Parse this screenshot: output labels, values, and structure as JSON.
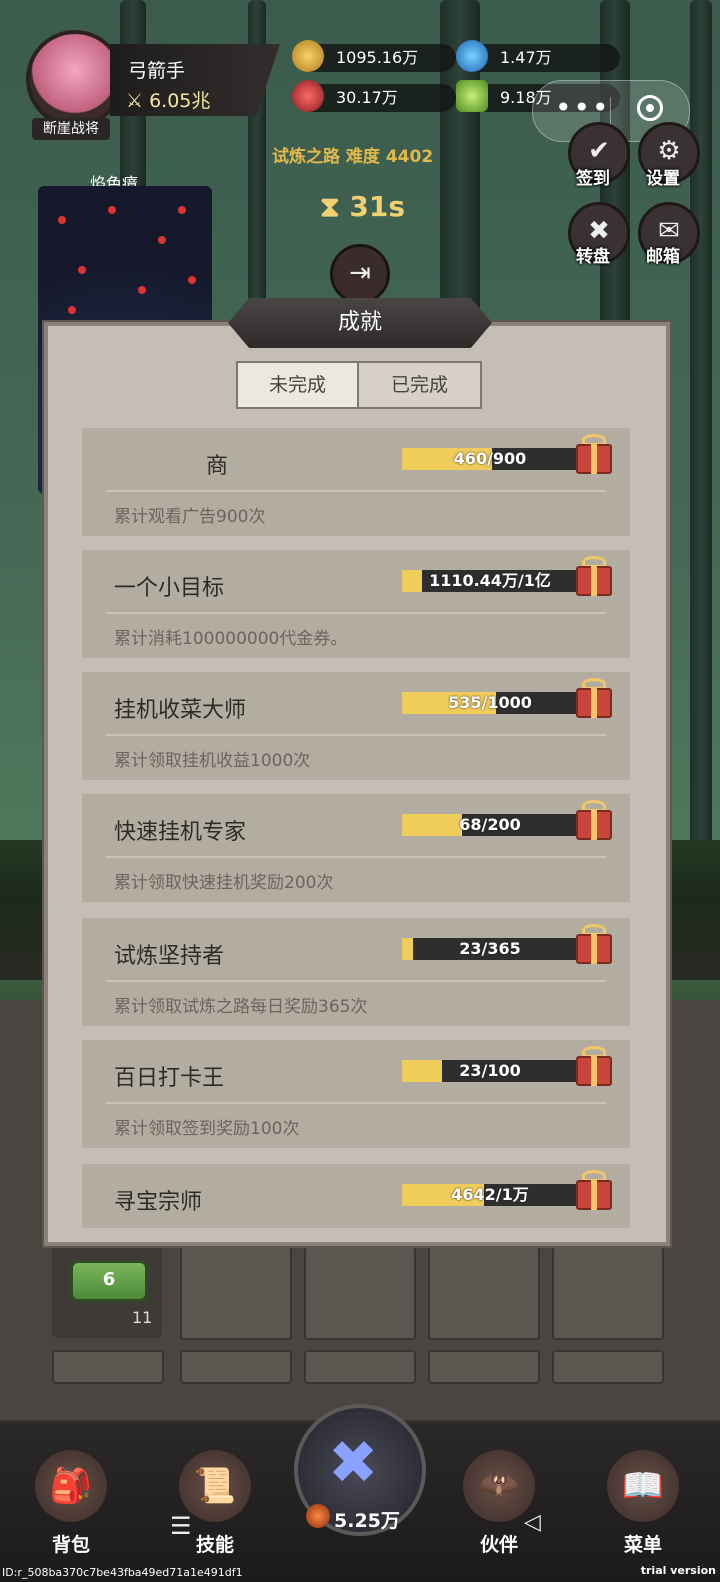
{
  "hud": {
    "hero_name": "弓箭手",
    "power": "6.05兆",
    "rank_tag": "断崖战将",
    "resources": [
      {
        "icon": "gold-star-coin-icon",
        "value": "1095.16万"
      },
      {
        "icon": "blue-gem-icon",
        "value": "1.47万"
      },
      {
        "icon": "red-ruby-icon",
        "value": "30.17万"
      },
      {
        "icon": "green-ticket-icon",
        "value": "9.18万"
      }
    ],
    "trial_title": "试炼之路 难度 4402",
    "timer": "31s",
    "exit_label": "退出"
  },
  "video": {
    "player_name": "焰色瘴"
  },
  "side_buttons": [
    {
      "label": "签到",
      "icon": "checkin-icon"
    },
    {
      "label": "设置",
      "icon": "gear-icon"
    },
    {
      "label": "转盘",
      "icon": "wheel-icon"
    },
    {
      "label": "邮箱",
      "icon": "mail-icon"
    }
  ],
  "dialog": {
    "title": "成就",
    "tabs": [
      "未完成",
      "已完成"
    ],
    "items": [
      {
        "title": "商",
        "desc": "累计观看广告900次",
        "progress_text": "460/900",
        "progress": 0.511
      },
      {
        "title": "一个小目标",
        "desc": "累计消耗100000000代金券。",
        "progress_text": "1110.44万/1亿",
        "progress": 0.111
      },
      {
        "title": "挂机收菜大师",
        "desc": "累计领取挂机收益1000次",
        "progress_text": "535/1000",
        "progress": 0.535
      },
      {
        "title": "快速挂机专家",
        "desc": "累计领取快速挂机奖励200次",
        "progress_text": "68/200",
        "progress": 0.34
      },
      {
        "title": "试炼坚持者",
        "desc": "累计领取试炼之路每日奖励365次",
        "progress_text": "23/365",
        "progress": 0.063
      },
      {
        "title": "百日打卡王",
        "desc": "累计领取签到奖励100次",
        "progress_text": "23/100",
        "progress": 0.23
      },
      {
        "title": "寻宝宗师",
        "desc": "",
        "progress_text": "4642/1万",
        "progress": 0.464
      }
    ]
  },
  "grid": {
    "badge": "6",
    "slot_count": "11"
  },
  "nav": {
    "items": [
      {
        "label": "背包",
        "icon": "backpack-icon"
      },
      {
        "label": "技能",
        "icon": "scroll-icon"
      },
      {
        "label": "伙伴",
        "icon": "wings-icon"
      },
      {
        "label": "菜单",
        "icon": "book-icon"
      }
    ],
    "center_value": "5.25万"
  },
  "footer": {
    "id_text": "ID:r_508ba370c7be43fba49ed71a1e491df1",
    "trial_text": "trial version"
  }
}
